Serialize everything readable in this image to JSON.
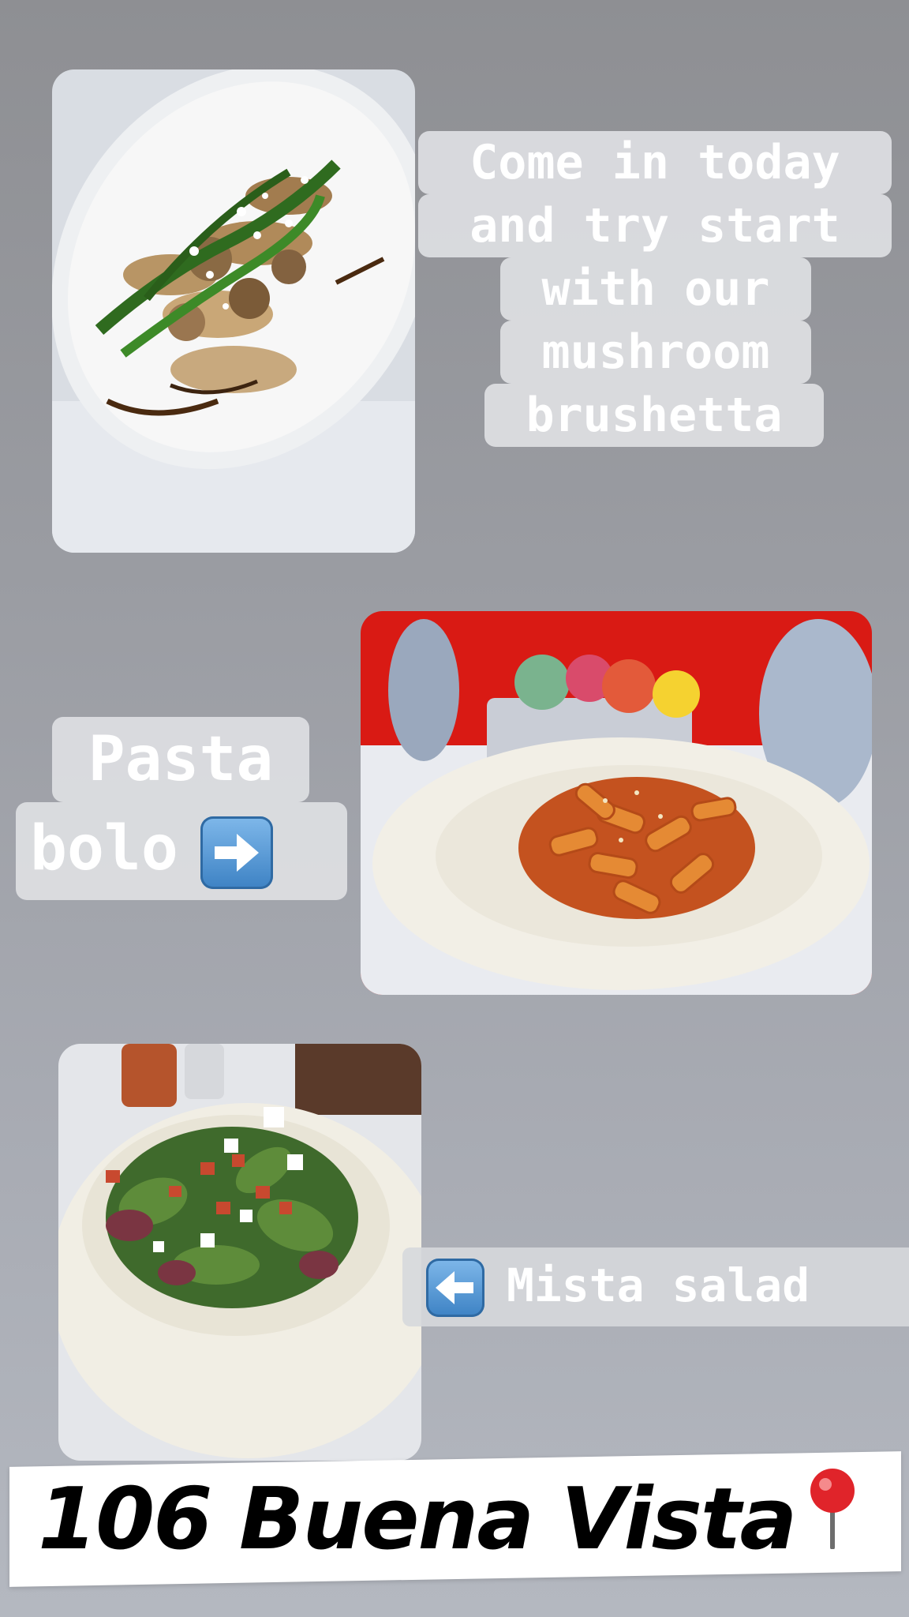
{
  "captions": {
    "brushetta": [
      "Come in today",
      "and try start",
      "with our",
      "mushroom",
      "brushetta"
    ],
    "pasta": [
      "Pasta",
      "bolo"
    ],
    "salad": "Mista salad"
  },
  "address": "106 Buena Vista",
  "icons": {
    "pasta_arrow": "right-arrow-icon",
    "salad_arrow": "left-arrow-icon",
    "location": "round-pushpin-icon"
  },
  "colors": {
    "caption_bg": "#dedfe2",
    "caption_text": "#ffffff",
    "arrow_blue": "#3d82c4",
    "pin_red": "#e0242a"
  }
}
